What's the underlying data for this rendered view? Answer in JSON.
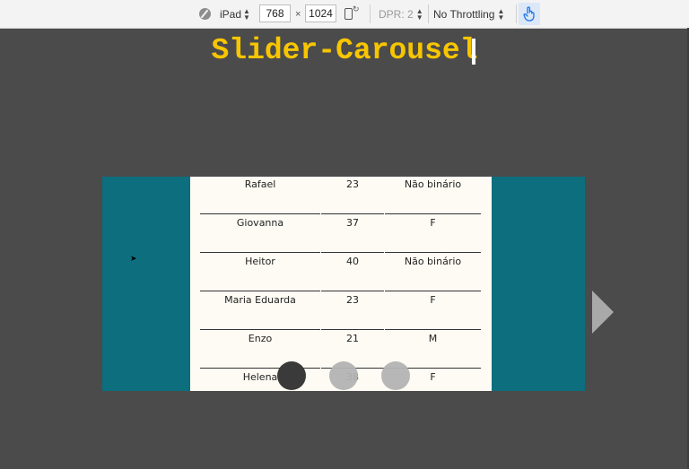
{
  "devtools": {
    "device": "iPad",
    "width": "768",
    "times": "×",
    "height": "1024",
    "dpr": "DPR: 2",
    "throttling": "No Throttling"
  },
  "page": {
    "title": "Slider-Carousel"
  },
  "carousel": {
    "rows": [
      {
        "name": "Rafael",
        "age": "23",
        "gender": "Não binário"
      },
      {
        "name": "Giovanna",
        "age": "37",
        "gender": "F"
      },
      {
        "name": "Heitor",
        "age": "40",
        "gender": "Não binário"
      },
      {
        "name": "Maria Eduarda",
        "age": "23",
        "gender": "F"
      },
      {
        "name": "Enzo",
        "age": "21",
        "gender": "M"
      },
      {
        "name": "Helena",
        "age": "38",
        "gender": "F"
      }
    ],
    "active_dot": 0,
    "dot_count": 3
  },
  "colors": {
    "title": "#f7c600",
    "carousel_bg": "#0d6e7e",
    "slide_bg": "#fdfbf3",
    "page_bg": "#4b4b4b"
  },
  "icons": [
    "no-device-icon",
    "sort-icon",
    "rotate-icon",
    "touch-icon",
    "next-arrow-icon",
    "cursor-icon"
  ]
}
